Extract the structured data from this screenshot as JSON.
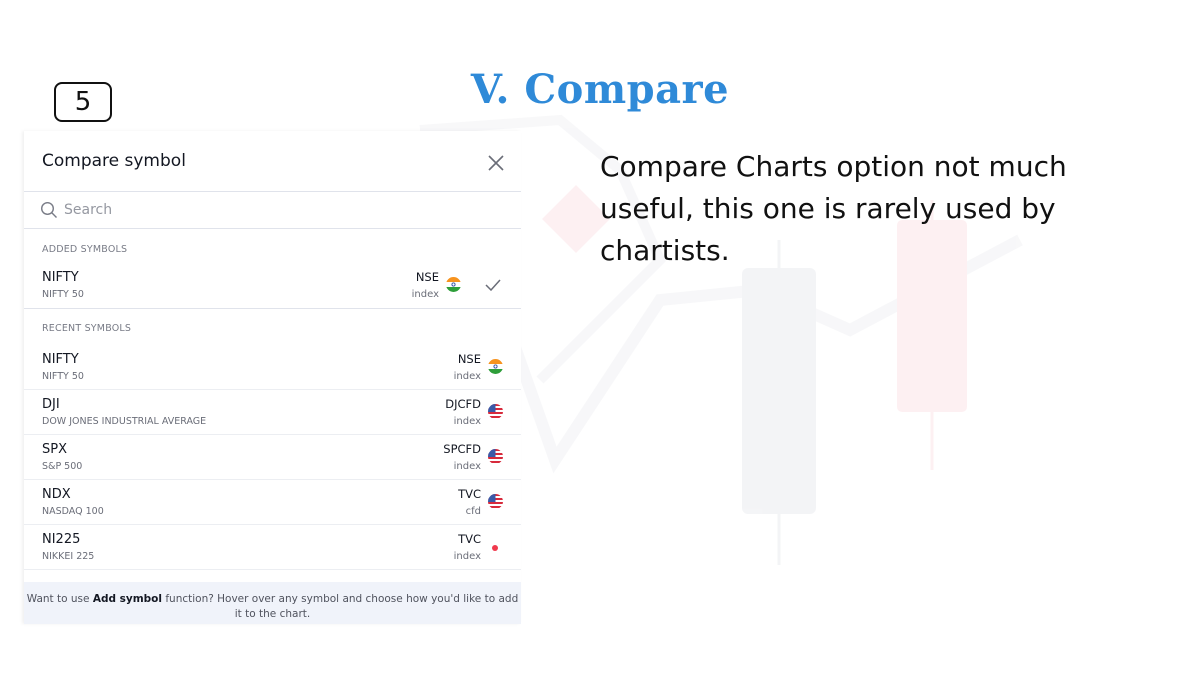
{
  "slide": {
    "number": "5",
    "title": "V. Compare",
    "description": "Compare Charts option not much useful, this one is rarely used by chartists."
  },
  "dialog": {
    "title": "Compare symbol",
    "search_placeholder": "Search",
    "added_header": "ADDED SYMBOLS",
    "recent_header": "RECENT SYMBOLS",
    "added": [
      {
        "symbol": "NIFTY",
        "description": "NIFTY 50",
        "exchange": "NSE",
        "type": "index",
        "flag": "india-flag-icon"
      }
    ],
    "recent": [
      {
        "symbol": "NIFTY",
        "description": "NIFTY 50",
        "exchange": "NSE",
        "type": "index",
        "flag": "india-flag-icon"
      },
      {
        "symbol": "DJI",
        "description": "DOW JONES INDUSTRIAL AVERAGE",
        "exchange": "DJCFD",
        "type": "index",
        "flag": "usa-flag-icon"
      },
      {
        "symbol": "SPX",
        "description": "S&P 500",
        "exchange": "SPCFD",
        "type": "index",
        "flag": "usa-flag-icon"
      },
      {
        "symbol": "NDX",
        "description": "NASDAQ 100",
        "exchange": "TVC",
        "type": "cfd",
        "flag": "usa-flag-icon"
      },
      {
        "symbol": "NI225",
        "description": "NIKKEI 225",
        "exchange": "TVC",
        "type": "index",
        "flag": "japan-dot-icon"
      }
    ],
    "footer": {
      "before": "Want to use ",
      "bold": "Add symbol",
      "after": " function? Hover over any symbol and choose how you'd like to add it to the chart."
    }
  },
  "colors": {
    "title": "#2f8ad8",
    "footer_bg": "#f0f3fa",
    "japan_dot": "#f0394d"
  }
}
